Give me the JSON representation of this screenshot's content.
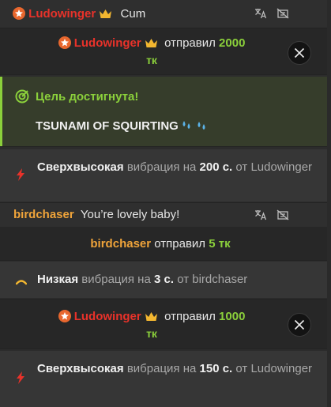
{
  "msg1": {
    "user": "Ludowinger",
    "text": "Cum"
  },
  "tip1": {
    "user": "Ludowinger",
    "verb": "отправил",
    "amount": "2000",
    "unit": "тк"
  },
  "goal": {
    "title": "Цель достигнута!",
    "text": "TSUNAMI OF SQUIRTING"
  },
  "vibe1": {
    "level": "Сверхвысокая",
    "mid": "вибрация на",
    "duration": "200 с.",
    "from": "от",
    "user": "Ludowinger"
  },
  "msg2": {
    "user": "birdchaser",
    "text": "You’re lovely baby!"
  },
  "tip2": {
    "user": "birdchaser",
    "verb": "отправил",
    "amount": "5 тк"
  },
  "vibe2": {
    "level": "Низкая",
    "mid": "вибрация на",
    "duration": "3 с.",
    "from": "от",
    "user": "birdchaser"
  },
  "tip3": {
    "user": "Ludowinger",
    "verb": "отправил",
    "amount": "1000",
    "unit": "тк"
  },
  "vibe3": {
    "level": "Сверхвысокая",
    "mid": "вибрация на",
    "duration": "150 с.",
    "from": "от",
    "user": "Ludowinger"
  },
  "colors": {
    "red_user": "#e8322a",
    "orange_user": "#f0a43a",
    "token_green": "#8bd03b",
    "avatar": "#e8672e"
  },
  "icons": [
    "translate-icon",
    "hide-icon",
    "x-close-icon",
    "goal-target-icon",
    "lightning-icon",
    "low-vibe-icon",
    "crown-icon",
    "water-drops-icon"
  ]
}
